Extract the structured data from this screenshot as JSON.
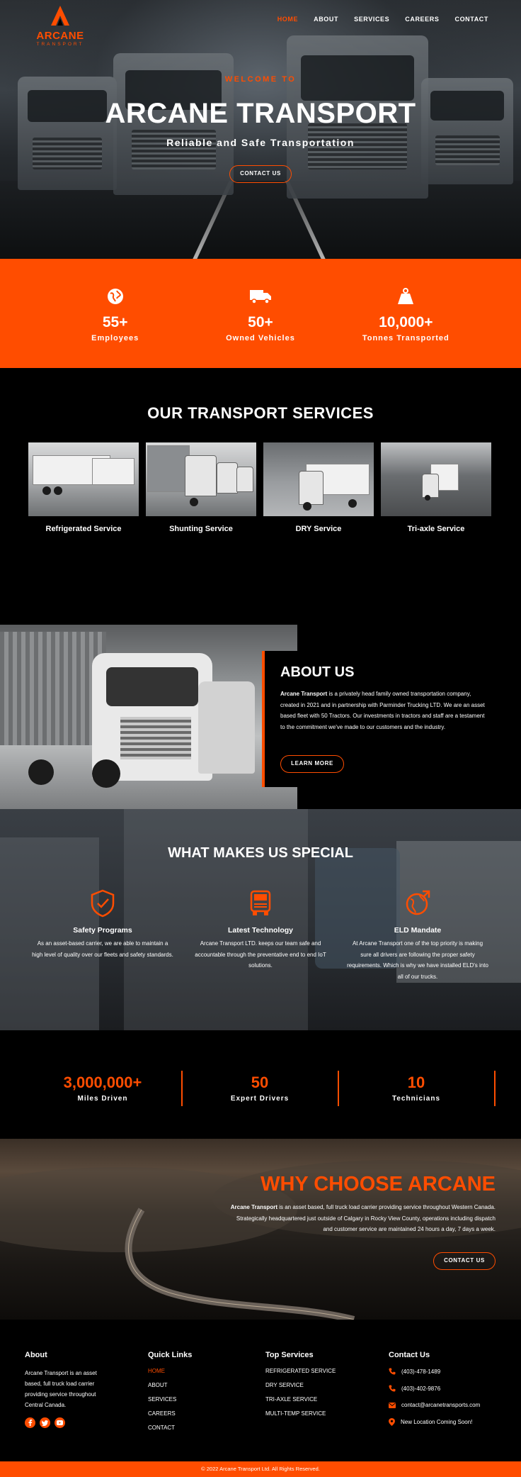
{
  "brand": {
    "name": "ARCANE",
    "sub": "TRANSPORT"
  },
  "nav": {
    "items": [
      "HOME",
      "ABOUT",
      "SERVICES",
      "CAREERS",
      "CONTACT"
    ]
  },
  "hero": {
    "welcome": "WELCOME TO",
    "title": "ARCANE TRANSPORT",
    "tagline": "Reliable and Safe Transportation",
    "button": "CONTACT US"
  },
  "stats": [
    {
      "icon": "globe-icon",
      "value": "55+",
      "label": "Employees"
    },
    {
      "icon": "truck-icon",
      "value": "50+",
      "label": "Owned Vehicles"
    },
    {
      "icon": "weight-icon",
      "value": "10,000+",
      "label": "Tonnes Transported"
    }
  ],
  "services": {
    "title": "OUR TRANSPORT SERVICES",
    "items": [
      {
        "label": "Refrigerated Service"
      },
      {
        "label": "Shunting Service"
      },
      {
        "label": "DRY Service"
      },
      {
        "label": "Tri-axle Service"
      }
    ]
  },
  "about": {
    "title": "ABOUT US",
    "lead": "Arcane Transport",
    "text": " is a privately head family owned transportation company, created in 2021 and in partnership with Parminder Trucking LTD. We are an asset based fleet with 50 Tractors. Our investments in tractors and staff are a testament to the commitment we've made to our customers and the industry.",
    "button": "LEARN MORE"
  },
  "special": {
    "title": "WHAT MAKES US SPECIAL",
    "items": [
      {
        "icon": "shield-check-icon",
        "title": "Safety Programs",
        "text": "As an asset-based carrier, we are able to maintain a high level of quality over our fleets and safety standards."
      },
      {
        "icon": "truck-front-icon",
        "title": "Latest Technology",
        "text": "Arcane Transport LTD. keeps our team safe and accountable through the preventative end to end IoT solutions."
      },
      {
        "icon": "globe-arrow-icon",
        "title": "ELD Mandate",
        "text": "At Arcane Transport one of the top priority is making sure all drivers are following the proper safety requirements. Which is why we have installed ELD's into all of our trucks."
      }
    ]
  },
  "counters": [
    {
      "value": "3,000,000+",
      "label": "Miles Driven"
    },
    {
      "value": "50",
      "label": "Expert Drivers"
    },
    {
      "value": "10",
      "label": "Technicians"
    }
  ],
  "why": {
    "title": "WHY CHOOSE ARCANE",
    "lead": "Arcane Transport",
    "text": " is an asset based, full truck load carrier providing service throughout Western Canada. Strategically headquartered just outside of Calgary in Rocky View County, operations including dispatch and customer service are maintained 24 hours a day, 7 days a week.",
    "button": "CONTACT US"
  },
  "footer": {
    "about_title": "About",
    "about_text": "Arcane Transport is an asset based, full truck load carrier providing service throughout Central Canada.",
    "social": [
      "facebook-icon",
      "twitter-icon",
      "youtube-icon"
    ],
    "links_title": "Quick Links",
    "links": [
      "HOME",
      "ABOUT",
      "SERVICES",
      "CAREERS",
      "CONTACT"
    ],
    "services_title": "Top Services",
    "services": [
      "REFRIGERATED SERVICE",
      "DRY SERVICE",
      "TRI-AXLE SERVICE",
      "MULTI-TEMP SERVICE"
    ],
    "contact_title": "Contact Us",
    "contacts": [
      {
        "icon": "phone-icon",
        "text": "(403)-478-1489"
      },
      {
        "icon": "phone-icon",
        "text": "(403)-402-9876"
      },
      {
        "icon": "mail-icon",
        "text": "contact@arcanetransports.com"
      },
      {
        "icon": "location-icon",
        "text": "New Location Coming Soon!"
      }
    ],
    "copyright": "© 2022 Arcane Transport Ltd. All Rights Reserved."
  },
  "colors": {
    "accent": "#ff4d00",
    "background": "#000000"
  }
}
